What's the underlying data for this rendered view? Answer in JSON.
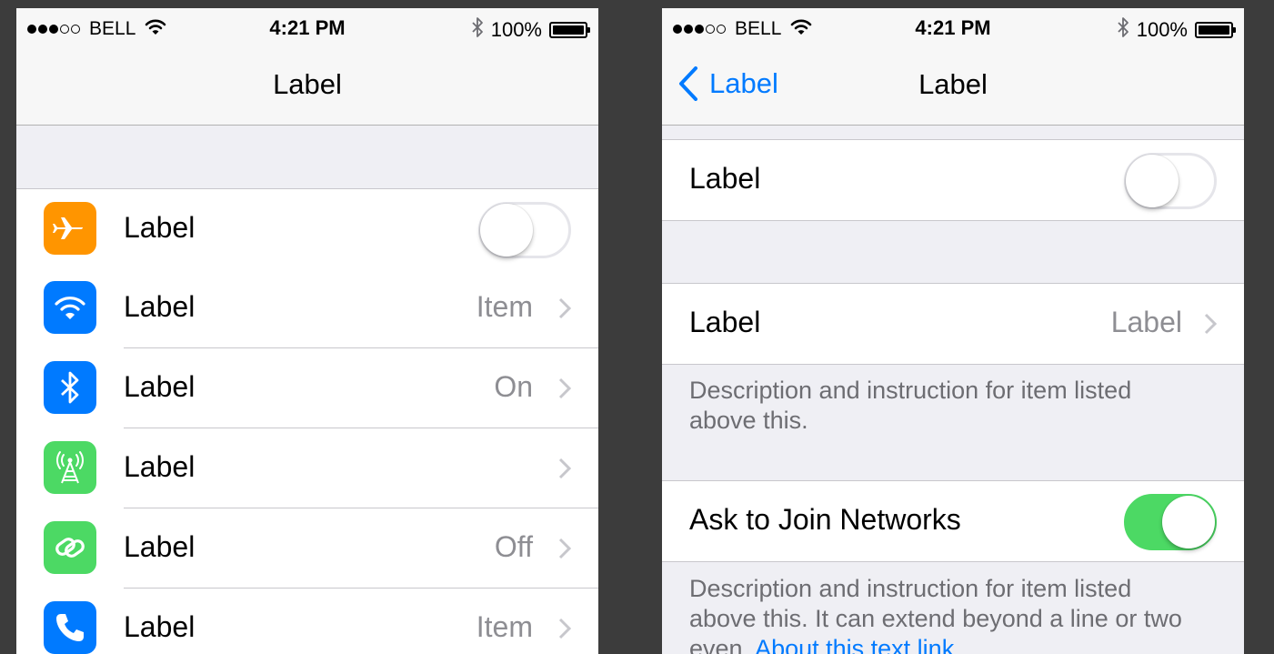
{
  "status_bar": {
    "carrier": "BELL",
    "time": "4:21 PM",
    "battery": "100%",
    "signal_bars_filled": 3,
    "signal_bars_total": 5
  },
  "left_screen": {
    "nav_title": "Label",
    "rows": [
      {
        "label": "Label",
        "value": "",
        "icon": "airplane-icon",
        "icon_color": "#ff9500",
        "accessory": "toggle",
        "toggle_on": false
      },
      {
        "label": "Label",
        "value": "Item",
        "icon": "wifi-icon",
        "icon_color": "#007aff",
        "accessory": "chevron"
      },
      {
        "label": "Label",
        "value": "On",
        "icon": "bluetooth-icon",
        "icon_color": "#007aff",
        "accessory": "chevron"
      },
      {
        "label": "Label",
        "value": "",
        "icon": "cellular-tower-icon",
        "icon_color": "#4cd964",
        "accessory": "chevron"
      },
      {
        "label": "Label",
        "value": "Off",
        "icon": "personal-hotspot-icon",
        "icon_color": "#4cd964",
        "accessory": "chevron"
      },
      {
        "label": "Label",
        "value": "Item",
        "icon": "phone-icon",
        "icon_color": "#007aff",
        "accessory": "chevron"
      }
    ]
  },
  "right_screen": {
    "back_label": "Label",
    "nav_title": "Label",
    "toggle_row": {
      "label": "Label",
      "toggle_on": false
    },
    "detail_row": {
      "label": "Label",
      "value": "Label"
    },
    "description_1": "Description and instruction for item listed above this.",
    "ask_row": {
      "label": "Ask to Join Networks",
      "toggle_on": true
    },
    "description_2": "Description and instruction for item listed above this. It can extend beyond a line or two even.",
    "description_2_link": "About this text link."
  },
  "colors": {
    "accent_blue": "#007aff",
    "switch_green": "#4cd964",
    "orange": "#ff9500",
    "secondary_text": "#8e8e93",
    "group_background": "#efeff4"
  }
}
